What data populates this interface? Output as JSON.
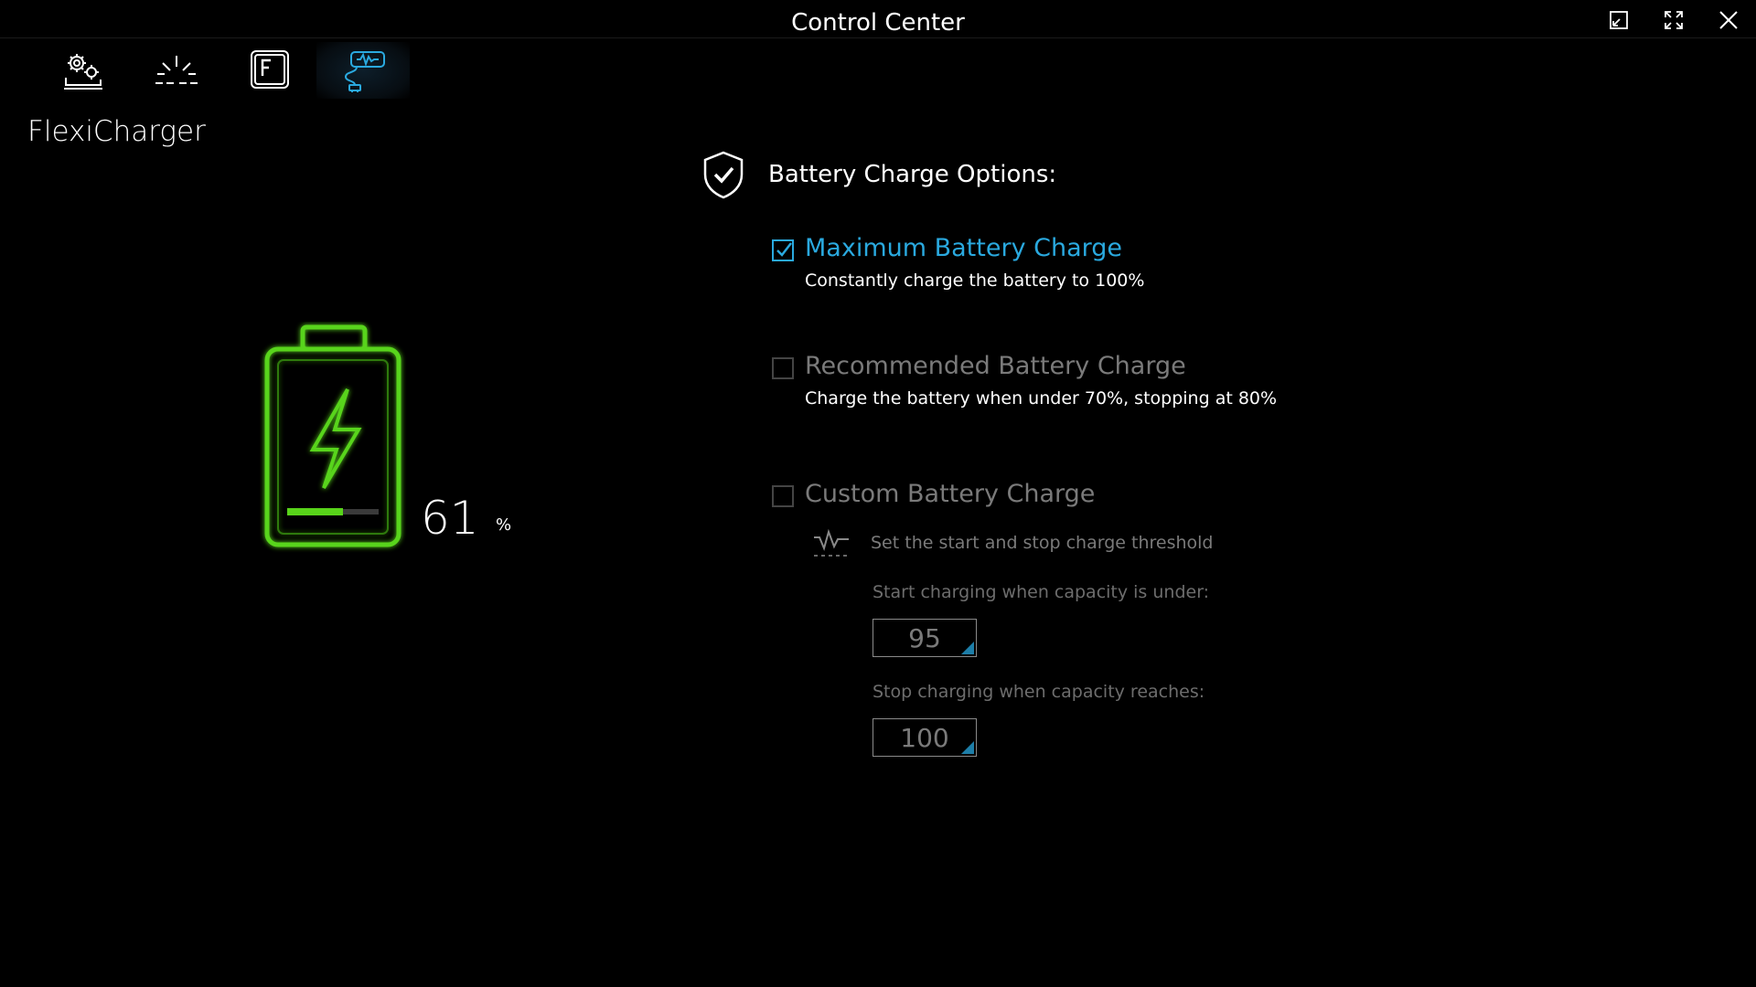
{
  "window": {
    "title": "Control Center",
    "controls": [
      "restore-icon",
      "fullscreen-icon",
      "close-icon"
    ]
  },
  "tabs": [
    {
      "icon": "system-settings-icon",
      "active": false
    },
    {
      "icon": "brightness-icon",
      "active": false
    },
    {
      "icon": "fn-key-icon",
      "active": false
    },
    {
      "icon": "battery-charger-plug-icon",
      "active": true
    }
  ],
  "page": {
    "title": "FlexiCharger"
  },
  "battery": {
    "icon": "battery-charging-icon",
    "level": 61,
    "unit": "%",
    "color": "#58d41a"
  },
  "options": {
    "icon": "shield-check-icon",
    "title": "Battery Charge Options:",
    "items": [
      {
        "label": "Maximum Battery Charge",
        "description": "Constantly charge the battery to 100%",
        "checked": true
      },
      {
        "label": "Recommended Battery Charge",
        "description": "Charge the battery when under 70%, stopping at 80%",
        "checked": false
      },
      {
        "label": "Custom Battery Charge",
        "checked": false,
        "threshold": {
          "icon": "threshold-wave-icon",
          "text": "Set the start and stop charge threshold",
          "start_label": "Start charging when capacity is under:",
          "start_value": "95",
          "stop_label": "Stop charging when capacity reaches:",
          "stop_value": "100"
        }
      }
    ]
  },
  "colors": {
    "accent": "#2aa9df",
    "battery_green": "#58d41a",
    "disabled_text": "#7a7a7a",
    "background": "#000000"
  }
}
